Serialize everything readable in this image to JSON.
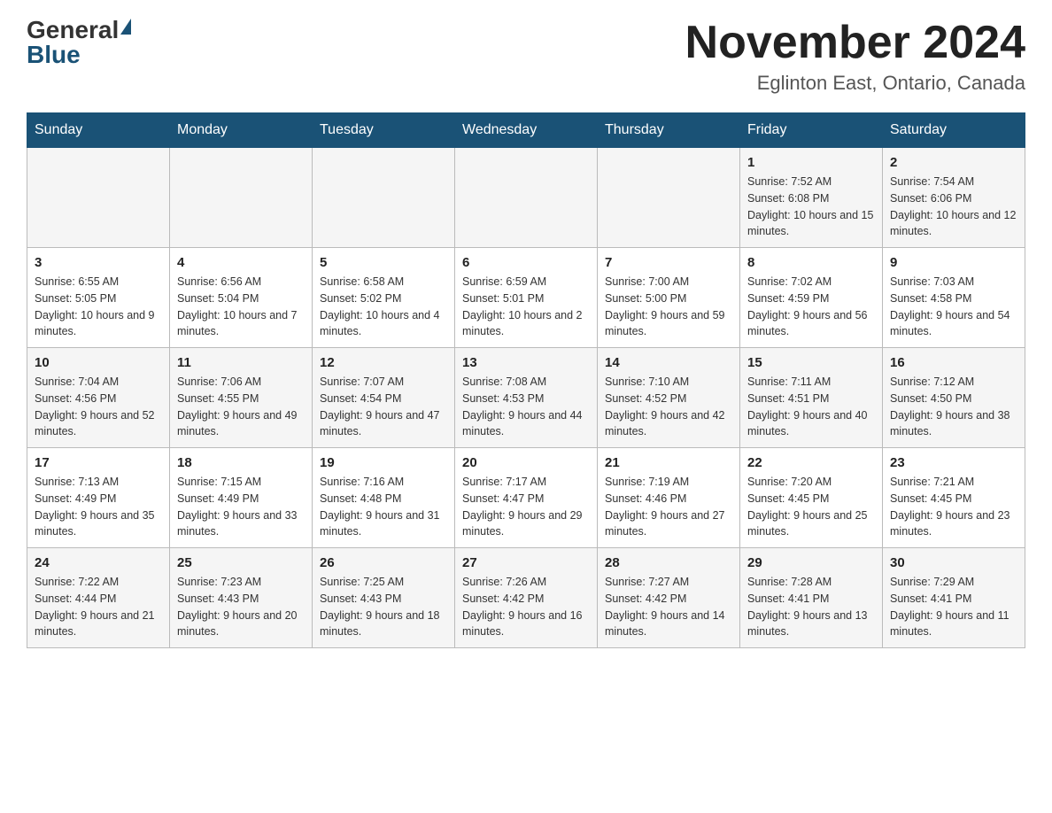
{
  "header": {
    "logo_general": "General",
    "logo_blue": "Blue",
    "month_title": "November 2024",
    "location": "Eglinton East, Ontario, Canada"
  },
  "weekdays": [
    "Sunday",
    "Monday",
    "Tuesday",
    "Wednesday",
    "Thursday",
    "Friday",
    "Saturday"
  ],
  "weeks": [
    [
      {
        "day": "",
        "info": ""
      },
      {
        "day": "",
        "info": ""
      },
      {
        "day": "",
        "info": ""
      },
      {
        "day": "",
        "info": ""
      },
      {
        "day": "",
        "info": ""
      },
      {
        "day": "1",
        "info": "Sunrise: 7:52 AM\nSunset: 6:08 PM\nDaylight: 10 hours and 15 minutes."
      },
      {
        "day": "2",
        "info": "Sunrise: 7:54 AM\nSunset: 6:06 PM\nDaylight: 10 hours and 12 minutes."
      }
    ],
    [
      {
        "day": "3",
        "info": "Sunrise: 6:55 AM\nSunset: 5:05 PM\nDaylight: 10 hours and 9 minutes."
      },
      {
        "day": "4",
        "info": "Sunrise: 6:56 AM\nSunset: 5:04 PM\nDaylight: 10 hours and 7 minutes."
      },
      {
        "day": "5",
        "info": "Sunrise: 6:58 AM\nSunset: 5:02 PM\nDaylight: 10 hours and 4 minutes."
      },
      {
        "day": "6",
        "info": "Sunrise: 6:59 AM\nSunset: 5:01 PM\nDaylight: 10 hours and 2 minutes."
      },
      {
        "day": "7",
        "info": "Sunrise: 7:00 AM\nSunset: 5:00 PM\nDaylight: 9 hours and 59 minutes."
      },
      {
        "day": "8",
        "info": "Sunrise: 7:02 AM\nSunset: 4:59 PM\nDaylight: 9 hours and 56 minutes."
      },
      {
        "day": "9",
        "info": "Sunrise: 7:03 AM\nSunset: 4:58 PM\nDaylight: 9 hours and 54 minutes."
      }
    ],
    [
      {
        "day": "10",
        "info": "Sunrise: 7:04 AM\nSunset: 4:56 PM\nDaylight: 9 hours and 52 minutes."
      },
      {
        "day": "11",
        "info": "Sunrise: 7:06 AM\nSunset: 4:55 PM\nDaylight: 9 hours and 49 minutes."
      },
      {
        "day": "12",
        "info": "Sunrise: 7:07 AM\nSunset: 4:54 PM\nDaylight: 9 hours and 47 minutes."
      },
      {
        "day": "13",
        "info": "Sunrise: 7:08 AM\nSunset: 4:53 PM\nDaylight: 9 hours and 44 minutes."
      },
      {
        "day": "14",
        "info": "Sunrise: 7:10 AM\nSunset: 4:52 PM\nDaylight: 9 hours and 42 minutes."
      },
      {
        "day": "15",
        "info": "Sunrise: 7:11 AM\nSunset: 4:51 PM\nDaylight: 9 hours and 40 minutes."
      },
      {
        "day": "16",
        "info": "Sunrise: 7:12 AM\nSunset: 4:50 PM\nDaylight: 9 hours and 38 minutes."
      }
    ],
    [
      {
        "day": "17",
        "info": "Sunrise: 7:13 AM\nSunset: 4:49 PM\nDaylight: 9 hours and 35 minutes."
      },
      {
        "day": "18",
        "info": "Sunrise: 7:15 AM\nSunset: 4:49 PM\nDaylight: 9 hours and 33 minutes."
      },
      {
        "day": "19",
        "info": "Sunrise: 7:16 AM\nSunset: 4:48 PM\nDaylight: 9 hours and 31 minutes."
      },
      {
        "day": "20",
        "info": "Sunrise: 7:17 AM\nSunset: 4:47 PM\nDaylight: 9 hours and 29 minutes."
      },
      {
        "day": "21",
        "info": "Sunrise: 7:19 AM\nSunset: 4:46 PM\nDaylight: 9 hours and 27 minutes."
      },
      {
        "day": "22",
        "info": "Sunrise: 7:20 AM\nSunset: 4:45 PM\nDaylight: 9 hours and 25 minutes."
      },
      {
        "day": "23",
        "info": "Sunrise: 7:21 AM\nSunset: 4:45 PM\nDaylight: 9 hours and 23 minutes."
      }
    ],
    [
      {
        "day": "24",
        "info": "Sunrise: 7:22 AM\nSunset: 4:44 PM\nDaylight: 9 hours and 21 minutes."
      },
      {
        "day": "25",
        "info": "Sunrise: 7:23 AM\nSunset: 4:43 PM\nDaylight: 9 hours and 20 minutes."
      },
      {
        "day": "26",
        "info": "Sunrise: 7:25 AM\nSunset: 4:43 PM\nDaylight: 9 hours and 18 minutes."
      },
      {
        "day": "27",
        "info": "Sunrise: 7:26 AM\nSunset: 4:42 PM\nDaylight: 9 hours and 16 minutes."
      },
      {
        "day": "28",
        "info": "Sunrise: 7:27 AM\nSunset: 4:42 PM\nDaylight: 9 hours and 14 minutes."
      },
      {
        "day": "29",
        "info": "Sunrise: 7:28 AM\nSunset: 4:41 PM\nDaylight: 9 hours and 13 minutes."
      },
      {
        "day": "30",
        "info": "Sunrise: 7:29 AM\nSunset: 4:41 PM\nDaylight: 9 hours and 11 minutes."
      }
    ]
  ]
}
